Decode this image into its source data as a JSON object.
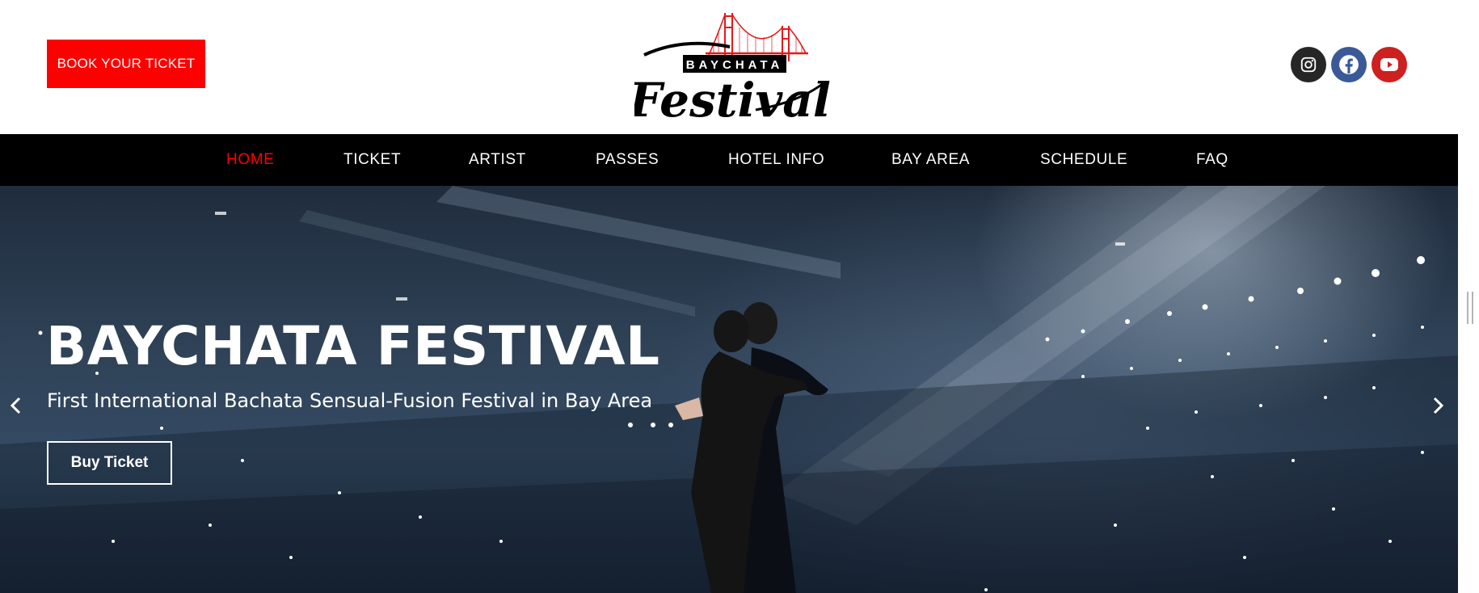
{
  "header": {
    "book_button": "BOOK YOUR TICKET",
    "logo": {
      "top_text": "BAYCHATA",
      "script_text": "Festival"
    },
    "social": [
      {
        "icon": "instagram-icon",
        "color": "#262626"
      },
      {
        "icon": "facebook-icon",
        "color": "#3b5998"
      },
      {
        "icon": "youtube-icon",
        "color": "#cd201f"
      }
    ]
  },
  "nav": {
    "items": [
      {
        "label": "HOME",
        "active": true
      },
      {
        "label": "TICKET",
        "active": false
      },
      {
        "label": "ARTIST",
        "active": false
      },
      {
        "label": "PASSES",
        "active": false
      },
      {
        "label": "HOTEL INFO",
        "active": false
      },
      {
        "label": "BAY AREA",
        "active": false
      },
      {
        "label": "SCHEDULE",
        "active": false
      },
      {
        "label": "FAQ",
        "active": false
      }
    ]
  },
  "hero": {
    "title": "BAYCHATA FESTIVAL",
    "subtitle": "First International Bachata Sensual-Fusion Festival in Bay Area",
    "cta": "Buy Ticket",
    "prev_icon": "chevron-left-icon",
    "next_icon": "chevron-right-icon"
  },
  "colors": {
    "accent": "#ff0000",
    "nav_bg": "#000000",
    "hero_bg": "#2f4257"
  }
}
